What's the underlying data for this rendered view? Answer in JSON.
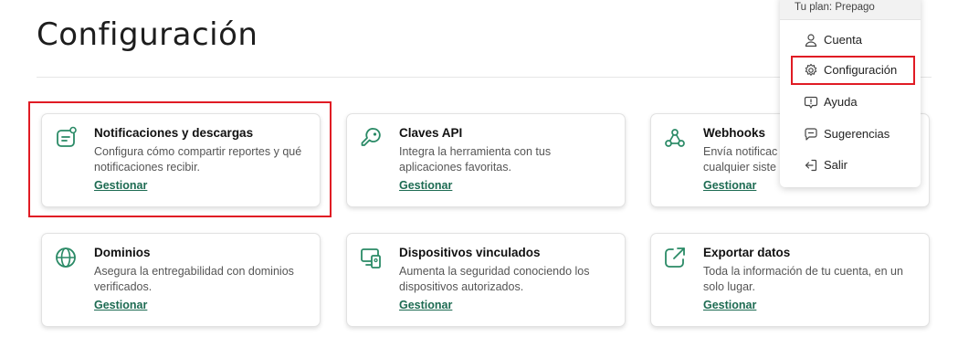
{
  "page": {
    "title": "Configuración"
  },
  "cards": [
    {
      "title": "Notificaciones y descargas",
      "desc": "Configura cómo compartir reportes y qué notificaciones recibir.",
      "link": "Gestionar",
      "icon": "notifications-icon"
    },
    {
      "title": "Claves API",
      "desc": "Integra la herramienta con tus aplicaciones favoritas.",
      "link": "Gestionar",
      "icon": "key-icon"
    },
    {
      "title": "Webhooks",
      "desc": "Envía notificac cualquier siste",
      "link": "Gestionar",
      "icon": "webhook-icon"
    },
    {
      "title": "Dominios",
      "desc": "Asegura la entregabilidad con dominios verificados.",
      "link": "Gestionar",
      "icon": "globe-icon"
    },
    {
      "title": "Dispositivos vinculados",
      "desc": "Aumenta la seguridad conociendo los dispositivos autorizados.",
      "link": "Gestionar",
      "icon": "devices-icon"
    },
    {
      "title": "Exportar datos",
      "desc": "Toda la información de tu cuenta, en un solo lugar.",
      "link": "Gestionar",
      "icon": "export-icon"
    }
  ],
  "menu": {
    "plan": "Tu plan: Prepago",
    "items": [
      {
        "label": "Cuenta",
        "icon": "user-icon"
      },
      {
        "label": "Configuración",
        "icon": "gear-icon"
      },
      {
        "label": "Ayuda",
        "icon": "help-icon"
      },
      {
        "label": "Sugerencias",
        "icon": "feedback-icon"
      },
      {
        "label": "Salir",
        "icon": "logout-icon"
      }
    ]
  },
  "colors": {
    "accent": "#1d6b52",
    "highlight": "#e01b24",
    "icon": "#2a8a66"
  }
}
